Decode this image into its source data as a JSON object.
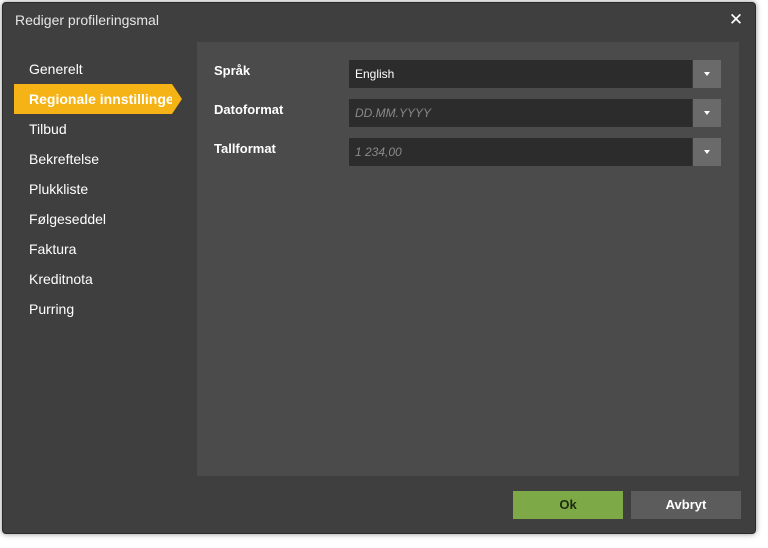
{
  "dialog": {
    "title": "Rediger profileringsmal",
    "close_symbol": "✕"
  },
  "sidebar": {
    "items": [
      {
        "label": "Generelt"
      },
      {
        "label": "Regionale innstillinger",
        "active": true
      },
      {
        "label": "Tilbud"
      },
      {
        "label": "Bekreftelse"
      },
      {
        "label": "Plukkliste"
      },
      {
        "label": "Følgeseddel"
      },
      {
        "label": "Faktura"
      },
      {
        "label": "Kreditnota"
      },
      {
        "label": "Purring"
      }
    ]
  },
  "form": {
    "language": {
      "label": "Språk",
      "value": "English"
    },
    "date_format": {
      "label": "Datoformat",
      "placeholder": "DD.MM.YYYY"
    },
    "number_format": {
      "label": "Tallformat",
      "placeholder": "1 234,00"
    }
  },
  "buttons": {
    "ok": "Ok",
    "cancel": "Avbryt"
  },
  "colors": {
    "active_tab": "#f5b315",
    "ok_button": "#7daa46",
    "dialog_bg": "#3f3f3f",
    "panel_bg": "#4b4b4b"
  }
}
